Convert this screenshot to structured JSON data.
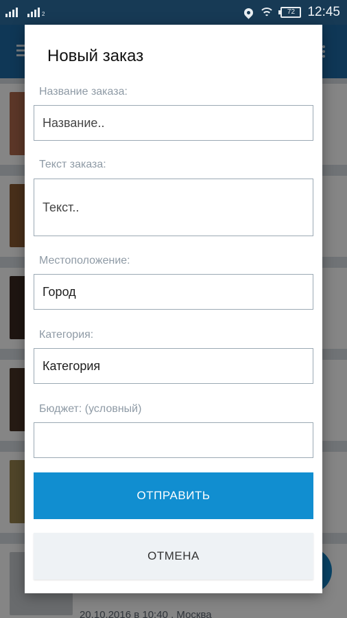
{
  "status_bar": {
    "time": "12:45",
    "battery": "72"
  },
  "background_list": {
    "last_item_meta": "20.10.2016 в 10:40 , Москва"
  },
  "dialog": {
    "title": "Новый заказ",
    "fields": {
      "name": {
        "label": "Название заказа:",
        "placeholder": "Название.."
      },
      "text": {
        "label": "Текст заказа:",
        "placeholder": "Текст.."
      },
      "location": {
        "label": "Местоположение:",
        "value": "Город"
      },
      "category": {
        "label": "Категория:",
        "value": "Категория"
      },
      "budget": {
        "label": "Бюджет: (условный)",
        "value": ""
      }
    },
    "buttons": {
      "submit": "ОТПРАВИТЬ",
      "cancel": "ОТМЕНА"
    }
  },
  "colors": {
    "status_bar": "#173a55",
    "app_bar": "#1e6aa5",
    "primary_button": "#118ed0",
    "secondary_button": "#eef2f5",
    "label": "#8e9aa5"
  }
}
